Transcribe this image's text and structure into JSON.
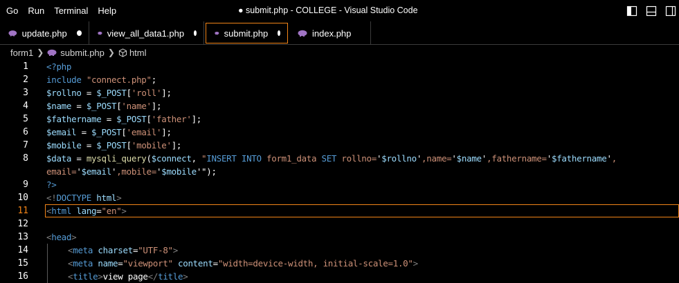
{
  "menu": {
    "items": [
      "Go",
      "Run",
      "Terminal",
      "Help"
    ]
  },
  "window": {
    "title": "● submit.php - COLLEGE - Visual Studio Code"
  },
  "tabs": [
    {
      "label": "update.php",
      "modified": true
    },
    {
      "label": "view_all_data1.php",
      "modified": true
    },
    {
      "label": "submit.php",
      "modified": true,
      "active": true
    },
    {
      "label": "index.php",
      "modified": false
    }
  ],
  "breadcrumb": {
    "folder": "form1",
    "file": "submit.php",
    "symbol": "html"
  },
  "editor": {
    "current_line": 11,
    "line_numbers": [
      "1",
      "2",
      "3",
      "4",
      "5",
      "6",
      "7",
      "8",
      "",
      "9",
      "10",
      "11",
      "12",
      "13",
      "14",
      "15",
      "16"
    ],
    "lines": {
      "l1": "<?php",
      "l2a": "include ",
      "l2b": "\"connect.php\"",
      "l2c": ";",
      "l3a": "$rollno",
      "l3b": " = ",
      "l3c": "$_POST",
      "l3d": "[",
      "l3e": "'roll'",
      "l3f": "];",
      "l4a": "$name",
      "l4b": " = ",
      "l4c": "$_POST",
      "l4d": "[",
      "l4e": "'name'",
      "l4f": "];",
      "l5a": "$fathername",
      "l5b": " = ",
      "l5c": "$_POST",
      "l5d": "[",
      "l5e": "'father'",
      "l5f": "];",
      "l6a": "$email",
      "l6b": " = ",
      "l6c": "$_POST",
      "l6d": "[",
      "l6e": "'email'",
      "l6f": "];",
      "l7a": "$mobile",
      "l7b": " = ",
      "l7c": "$_POST",
      "l7d": "[",
      "l7e": "'mobile'",
      "l7f": "];",
      "l8a": "$data",
      "l8b": " = ",
      "l8c": "mysqli_query",
      "l8d": "(",
      "l8e": "$connect",
      "l8f": ", ",
      "l8g": "\"",
      "l8h": "INSERT INTO",
      "l8i": " form1_data ",
      "l8j": "SET",
      "l8k": " rollno=",
      "l8l": "'",
      "l8m": "$rollno",
      "l8n": "'",
      "l8o": ",name=",
      "l8p": "'",
      "l8q": "$name",
      "l8r": "'",
      "l8s": ",fathername=",
      "l8t": "'",
      "l8u": "$fathername",
      "l8v": "'",
      "l8w": ",",
      "l8x": "email=",
      "l8y": "'",
      "l8z": "$email",
      "l8aa": "'",
      "l8ab": ",mobile=",
      "l8ac": "'",
      "l8ad": "$mobile",
      "l8ae": "'\"",
      "l8af": ");",
      "l9": "?>",
      "l10a": "<!",
      "l10b": "DOCTYPE",
      "l10c": " html",
      "l10d": ">",
      "l11a": "<",
      "l11b": "html",
      "l11c": " lang",
      "l11d": "=",
      "l11e": "\"en\"",
      "l11f": ">",
      "l13a": "<",
      "l13b": "head",
      "l13c": ">",
      "l14a": "<",
      "l14b": "meta",
      "l14c": " charset",
      "l14d": "=",
      "l14e": "\"UTF-8\"",
      "l14f": ">",
      "l15a": "<",
      "l15b": "meta",
      "l15c": " name",
      "l15d": "=",
      "l15e": "\"viewport\"",
      "l15f": " content",
      "l15g": "=",
      "l15h": "\"width=device-width, initial-scale=1.0\"",
      "l15i": ">",
      "l16a": "<",
      "l16b": "title",
      "l16c": ">",
      "l16d": "view page",
      "l16e": "</",
      "l16f": "title",
      "l16g": ">"
    }
  },
  "colors": {
    "background": "#000000",
    "accent_border": "#f38518",
    "keyword": "#569cd6",
    "string": "#ce9178",
    "variable": "#9cdcfe",
    "function": "#dcdcaa"
  },
  "icons": {
    "tab_file": "php-elephant-icon",
    "breadcrumb_symbol": "cube-icon",
    "layout": [
      "toggle-primary-sidebar-icon",
      "toggle-panel-icon",
      "toggle-secondary-sidebar-icon"
    ]
  }
}
